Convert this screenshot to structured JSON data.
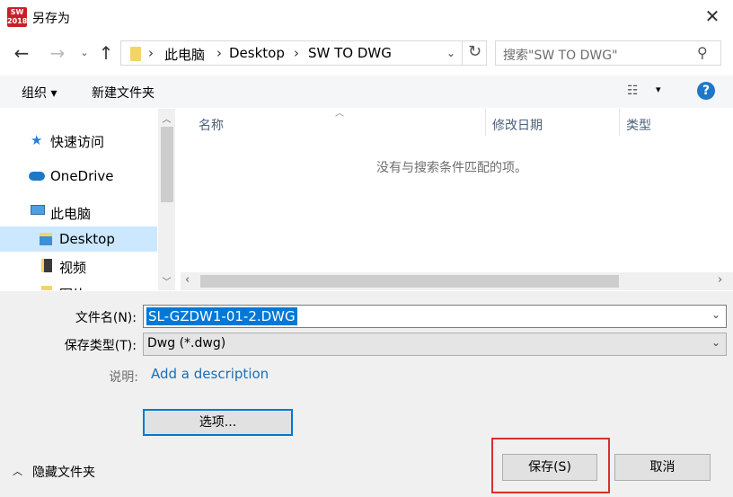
{
  "window": {
    "title": "另存为",
    "app_icon_text": "SW\n2018"
  },
  "address": {
    "crumbs": [
      "此电脑",
      "Desktop",
      "SW TO DWG"
    ]
  },
  "search": {
    "placeholder": "搜索\"SW TO DWG\""
  },
  "toolbar": {
    "organize": "组织",
    "new_folder": "新建文件夹"
  },
  "sidebar": {
    "items": [
      {
        "label": "快速访问",
        "icon": "star-icon"
      },
      {
        "label": "OneDrive",
        "icon": "cloud-icon"
      },
      {
        "label": "此电脑",
        "icon": "computer-icon"
      },
      {
        "label": "Desktop",
        "icon": "folder-icon",
        "selected": true
      },
      {
        "label": "视频",
        "icon": "video-folder-icon"
      },
      {
        "label": "图片",
        "icon": "picture-folder-icon"
      }
    ]
  },
  "filelist": {
    "columns": [
      "名称",
      "修改日期",
      "类型"
    ],
    "empty_message": "没有与搜索条件匹配的项。"
  },
  "form": {
    "filename_label": "文件名(N):",
    "filename_value": "SL-GZDW1-01-2.DWG",
    "filetype_label": "保存类型(T):",
    "filetype_value": "Dwg (*.dwg)",
    "desc_label": "说明:",
    "desc_link": "Add a description",
    "options_button": "选项..."
  },
  "footer": {
    "hide_folders": "隐藏文件夹",
    "save_button": "保存(S)",
    "cancel_button": "取消"
  },
  "colors": {
    "accent": "#0078d7",
    "highlight_box": "#d9302c",
    "link": "#1a6fb5"
  }
}
